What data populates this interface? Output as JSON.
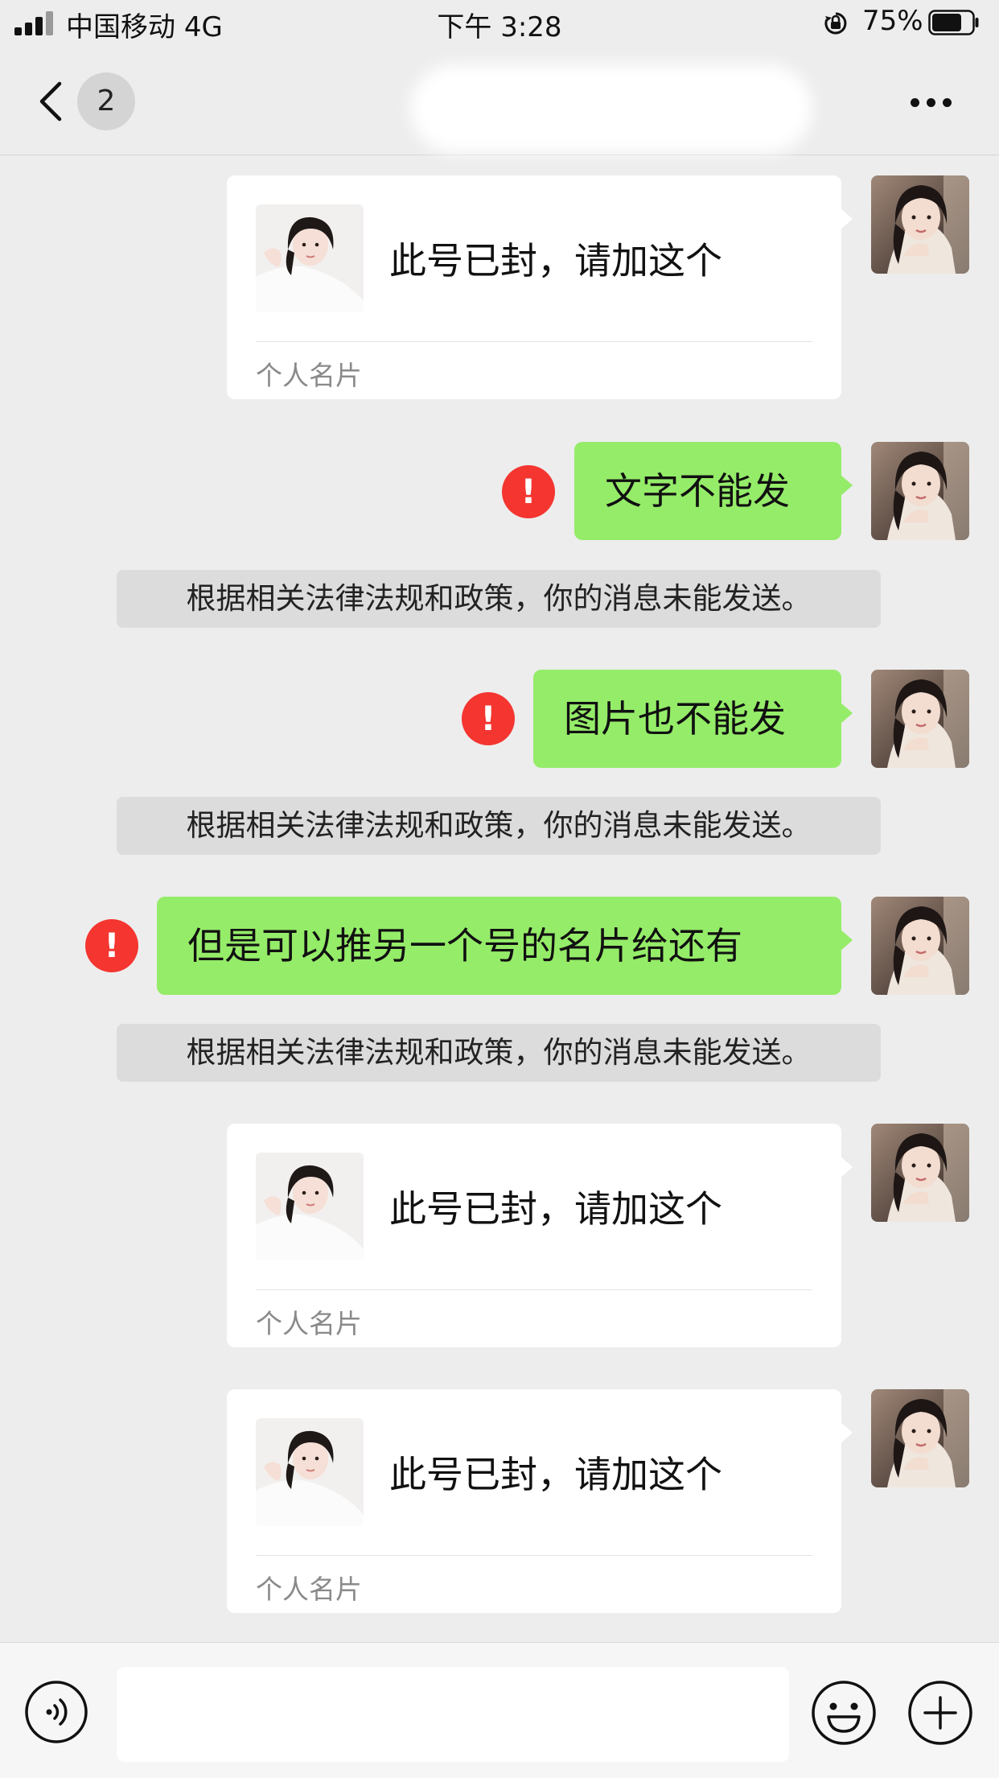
{
  "status_bar": {
    "carrier": "中国移动",
    "network": "4G",
    "time": "下午 3:28",
    "battery_percent": "75%",
    "battery_level": 0.75
  },
  "nav": {
    "unread_count": "2",
    "back_icon": "chevron-left-icon",
    "more_icon": "ellipsis-icon"
  },
  "messages": {
    "card_1": {
      "text": "此号已封，请加这个",
      "label": "个人名片"
    },
    "text_1": {
      "text": "文字不能发",
      "status": "!"
    },
    "notice_1": "根据相关法律法规和政策，你的消息未能发送。",
    "text_2": {
      "text": "图片也不能发",
      "status": "!"
    },
    "notice_2": "根据相关法律法规和政策，你的消息未能发送。",
    "text_3": {
      "text": "但是可以推另一个号的名片给还有",
      "status": "!"
    },
    "notice_3": "根据相关法律法规和政策，你的消息未能发送。",
    "card_2": {
      "text": "此号已封，请加这个",
      "label": "个人名片"
    },
    "card_3": {
      "text": "此号已封，请加这个",
      "label": "个人名片"
    }
  },
  "input_bar": {
    "voice_icon": "voice-icon",
    "emoji_icon": "emoji-icon",
    "plus_icon": "plus-circle-icon",
    "placeholder": ""
  },
  "colors": {
    "background": "#ededed",
    "bubble_green": "#95ec69",
    "error_red": "#f43530",
    "notice_bg": "#dcdcdc"
  }
}
